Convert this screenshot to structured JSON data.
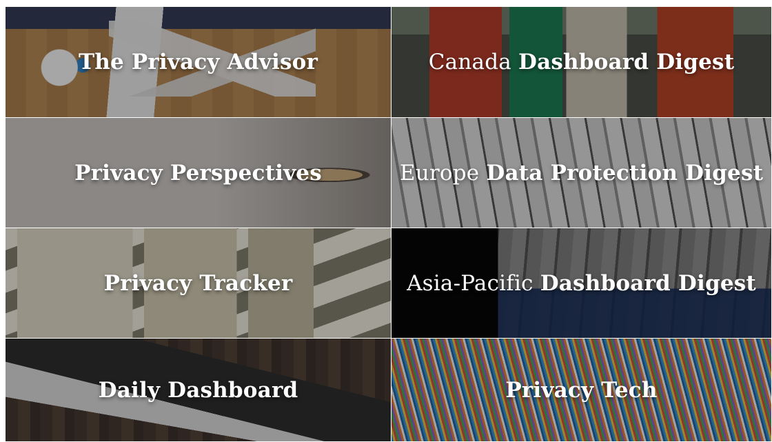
{
  "tiles": [
    {
      "id": "privacy-advisor",
      "light": "",
      "bold": "The Privacy Advisor"
    },
    {
      "id": "canada-digest",
      "light": "Canada",
      "bold": "Dashboard Digest"
    },
    {
      "id": "privacy-perspectives",
      "light": "",
      "bold": "Privacy Perspectives"
    },
    {
      "id": "europe-digest",
      "light": "Europe",
      "bold": "Data Protection Digest"
    },
    {
      "id": "privacy-tracker",
      "light": "",
      "bold": "Privacy Tracker"
    },
    {
      "id": "asia-pacific-digest",
      "light": "Asia-Pacific",
      "bold": "Dashboard Digest"
    },
    {
      "id": "daily-dashboard",
      "light": "",
      "bold": "Daily Dashboard"
    },
    {
      "id": "privacy-tech",
      "light": "",
      "bold": "Privacy Tech"
    }
  ]
}
